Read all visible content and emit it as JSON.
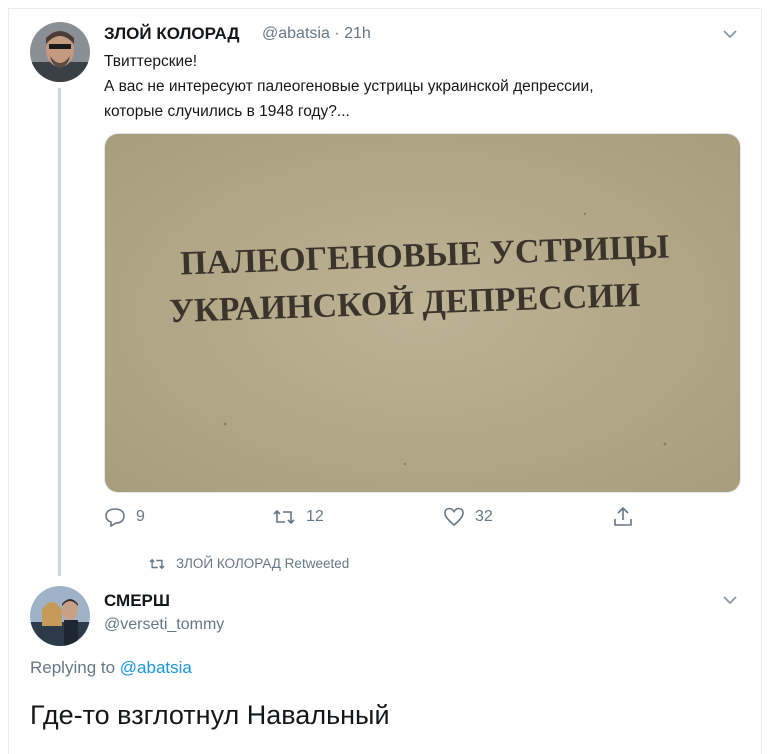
{
  "tweet1": {
    "author_name": "ЗЛОЙ КОЛОРАД",
    "handle": "@abatsia",
    "separator": "·",
    "time": "21h",
    "text_lines": [
      "Твиттерские!",
      "А вас не интересуют палеогеновые устрицы украинской депрессии,",
      "которые случились в 1948 году?..."
    ],
    "image_title_lines": [
      "ПАЛЕОГЕНОВЫЕ УСТРИЦЫ",
      "УКРАИНСКОЙ ДЕПРЕССИИ"
    ],
    "actions": {
      "reply_count": "9",
      "retweet_count": "12",
      "like_count": "32"
    }
  },
  "retweet_context": {
    "text": "ЗЛОЙ КОЛОРАД Retweeted"
  },
  "tweet2": {
    "author_name": "СМЕРШ",
    "handle": "@verseti_tommy",
    "replying_prefix": "Replying to",
    "replying_handle": "@abatsia",
    "text": "Где-то взглотнул Навальный"
  },
  "colors": {
    "text": "#14171a",
    "secondary": "#657786",
    "link": "#1b95e0",
    "line": "#ccd6dd",
    "paper": "#b8ad8c"
  },
  "icons": [
    "chevron-down-icon",
    "reply-icon",
    "retweet-icon",
    "like-icon",
    "share-icon"
  ]
}
